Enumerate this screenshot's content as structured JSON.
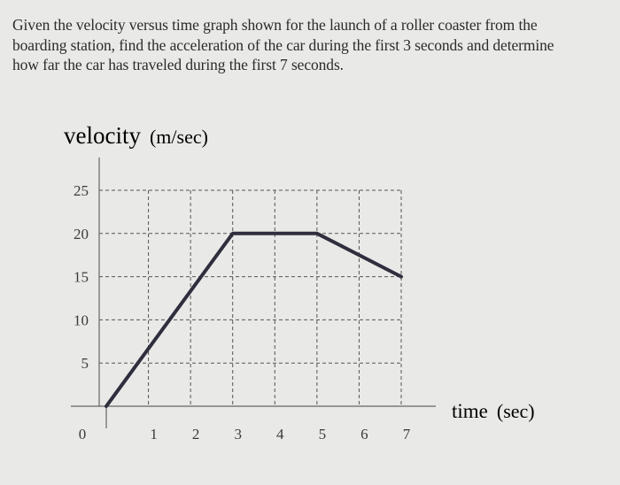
{
  "question": "Given the velocity versus time graph shown for the launch of a roller coaster from the boarding station, find the acceleration of the car during the first 3 seconds and determine how far the car has traveled during the first 7 seconds.",
  "chart_data": {
    "type": "line",
    "title": "",
    "ylabel": "velocity",
    "ylabel_unit": "(m/sec)",
    "xlabel": "time",
    "xlabel_unit": "(sec)",
    "x": [
      0,
      3,
      5,
      7
    ],
    "series": [
      {
        "name": "velocity",
        "values": [
          0,
          20,
          20,
          15
        ]
      }
    ],
    "xlim": [
      0,
      7
    ],
    "ylim": [
      0,
      25
    ],
    "xticks": [
      "0",
      "1",
      "2",
      "3",
      "4",
      "5",
      "6",
      "7"
    ],
    "yticks": [
      "5",
      "10",
      "15",
      "20",
      "25"
    ],
    "grid": true,
    "grid_style": "dashed",
    "line_color": "#2e2e3e",
    "legend": "none"
  }
}
